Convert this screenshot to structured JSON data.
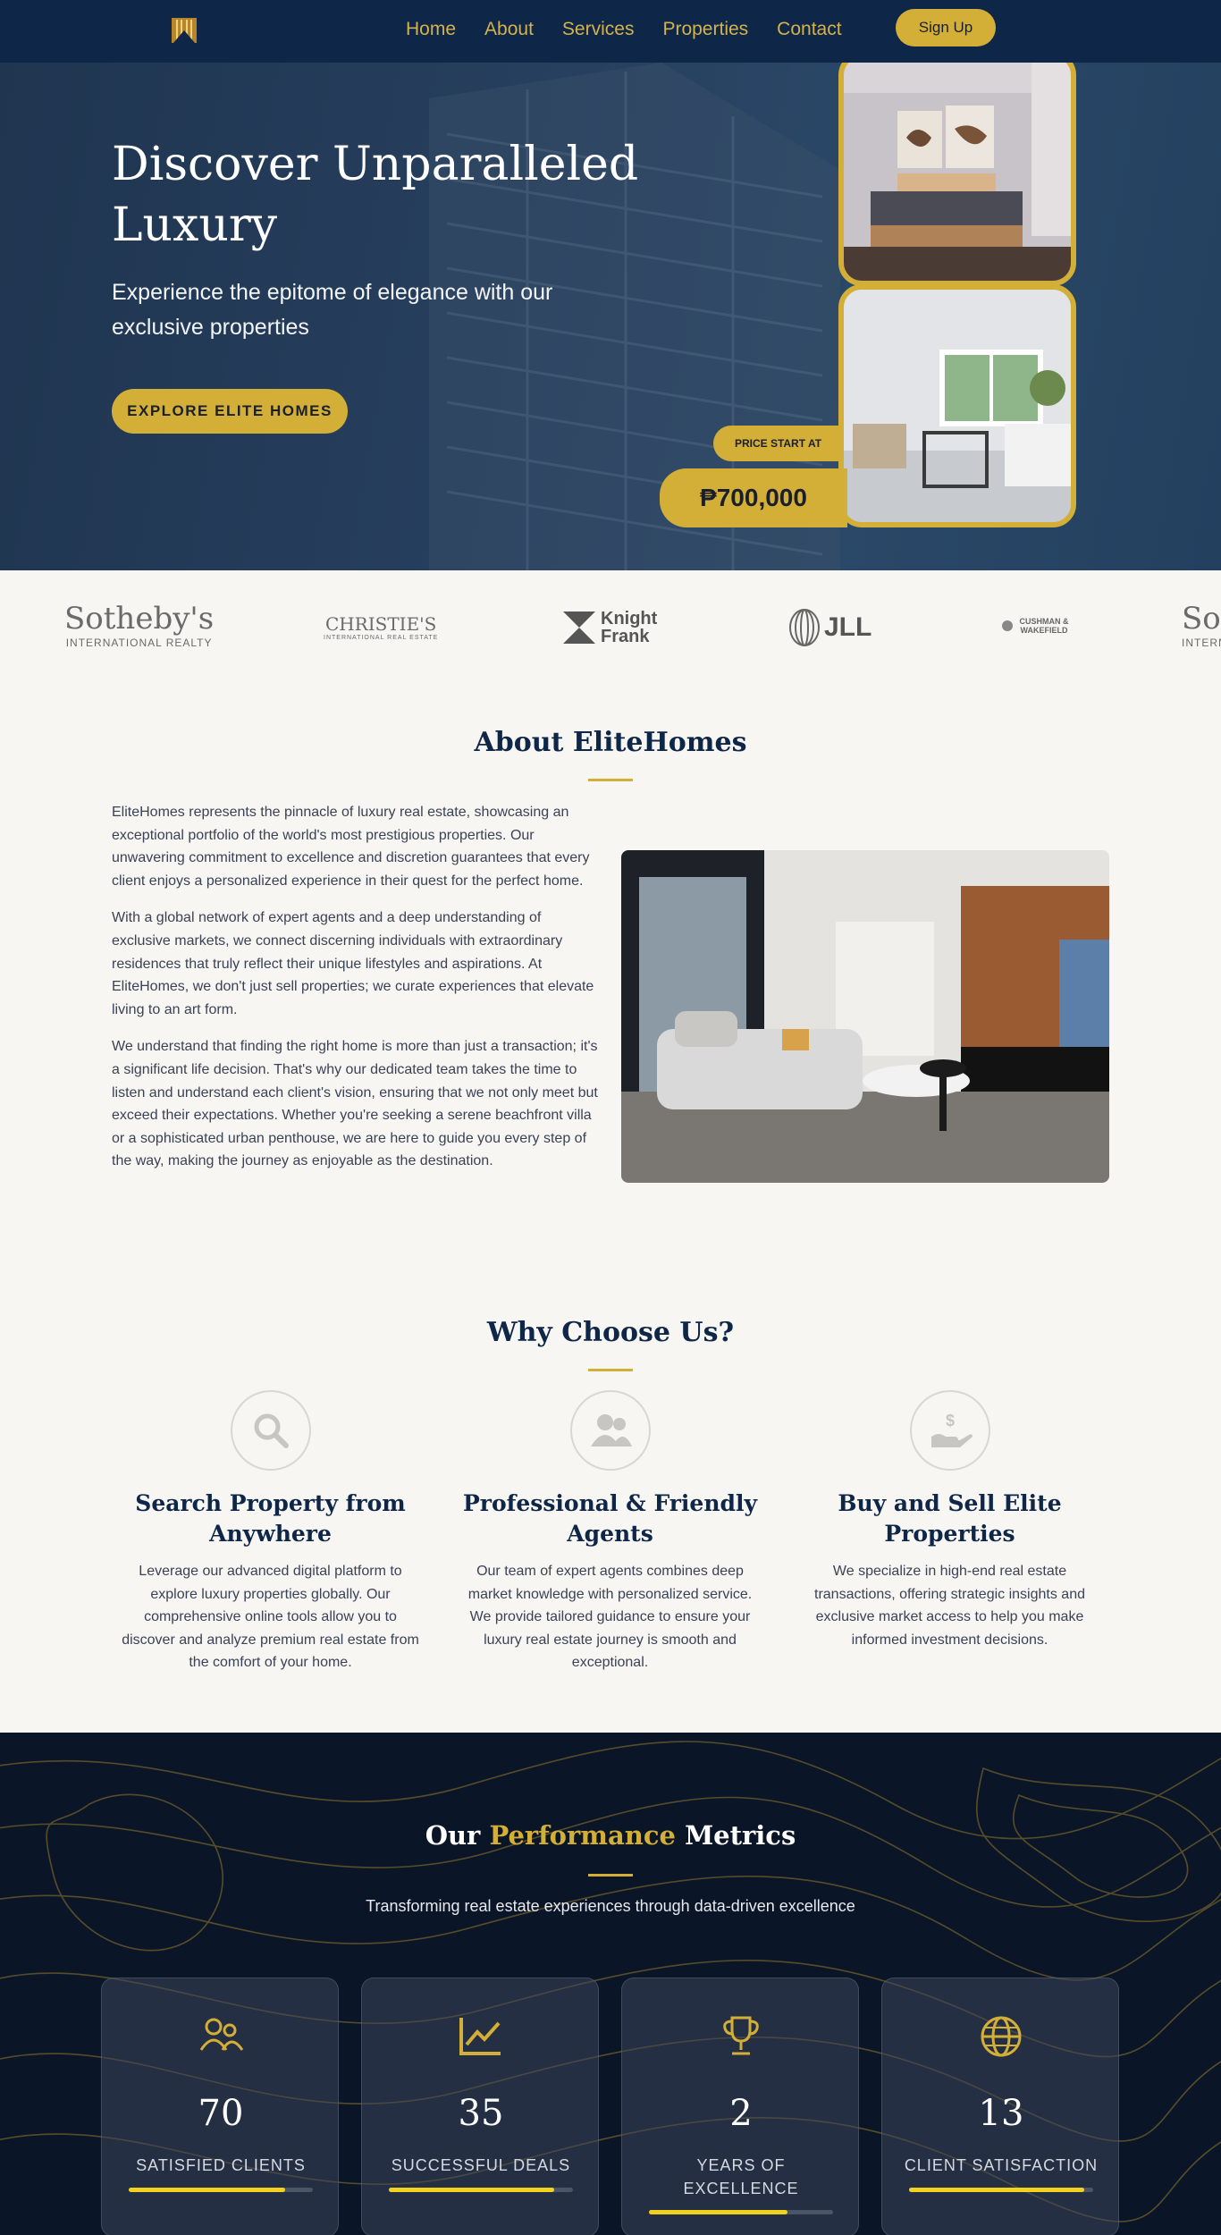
{
  "nav": {
    "links": [
      "Home",
      "About",
      "Services",
      "Properties",
      "Contact"
    ],
    "signup": "Sign Up"
  },
  "hero": {
    "title": "Discover Unparalleled Luxury",
    "subtitle": "Experience the epitome of elegance with our exclusive properties",
    "cta": "EXPLORE ELITE HOMES",
    "price_label": "PRICE START AT",
    "price_value": "₱700,000"
  },
  "brands": [
    {
      "name": "Sotheby's",
      "sub": "INTERNATIONAL REALTY"
    },
    {
      "name": "CHRISTIE'S",
      "sub": "INTERNATIONAL REAL ESTATE"
    },
    {
      "name": "Knight Frank",
      "sub": ""
    },
    {
      "name": "JLL",
      "sub": ""
    },
    {
      "name": "CUSHMAN & WAKEFIELD",
      "sub": ""
    },
    {
      "name": "Sotheby's",
      "sub": "INTERNATIONAL REALTY"
    }
  ],
  "about": {
    "title": "About EliteHomes",
    "paragraphs": [
      "EliteHomes represents the pinnacle of luxury real estate, showcasing an exceptional portfolio of the world's most prestigious properties. Our unwavering commitment to excellence and discretion guarantees that every client enjoys a personalized experience in their quest for the perfect home.",
      "With a global network of expert agents and a deep understanding of exclusive markets, we connect discerning individuals with extraordinary residences that truly reflect their unique lifestyles and aspirations. At EliteHomes, we don't just sell properties; we curate experiences that elevate living to an art form.",
      "We understand that finding the right home is more than just a transaction; it's a significant life decision. That's why our dedicated team takes the time to listen and understand each client's vision, ensuring that we not only meet but exceed their expectations. Whether you're seeking a serene beachfront villa or a sophisticated urban penthouse, we are here to guide you every step of the way, making the journey as enjoyable as the destination."
    ]
  },
  "why": {
    "title": "Why Choose Us?",
    "items": [
      {
        "icon": "search-icon",
        "title": "Search Property from Anywhere",
        "desc": "Leverage our advanced digital platform to explore luxury properties globally. Our comprehensive online tools allow you to discover and analyze premium real estate from the comfort of your home."
      },
      {
        "icon": "users-icon",
        "title": "Professional & Friendly Agents",
        "desc": "Our team of expert agents combines deep market knowledge with personalized service. We provide tailored guidance to ensure your luxury real estate journey is smooth and exceptional."
      },
      {
        "icon": "hand-dollar-icon",
        "title": "Buy and Sell Elite Properties",
        "desc": "We specialize in high-end real estate transactions, offering strategic insights and exclusive market access to help you make informed investment decisions."
      }
    ]
  },
  "metrics": {
    "title_before": "Our ",
    "title_accent": "Performance",
    "title_after": " Metrics",
    "subtitle": "Transforming real estate experiences through data-driven excellence",
    "items": [
      {
        "icon": "users-icon",
        "value": "70",
        "label": "SATISFIED CLIENTS",
        "progress": 0.85
      },
      {
        "icon": "chart-line-icon",
        "value": "35",
        "label": "SUCCESSFUL DEALS",
        "progress": 0.9
      },
      {
        "icon": "trophy-icon",
        "value": "2",
        "label": "YEARS OF EXCELLENCE",
        "progress": 0.75
      },
      {
        "icon": "globe-icon",
        "value": "13",
        "label": "CLIENT SATISFACTION",
        "progress": 0.95
      }
    ]
  },
  "colors": {
    "navy": "#0e2647",
    "gold": "#d4af37",
    "dark": "#0a1628",
    "cream": "#f8f6f2"
  }
}
